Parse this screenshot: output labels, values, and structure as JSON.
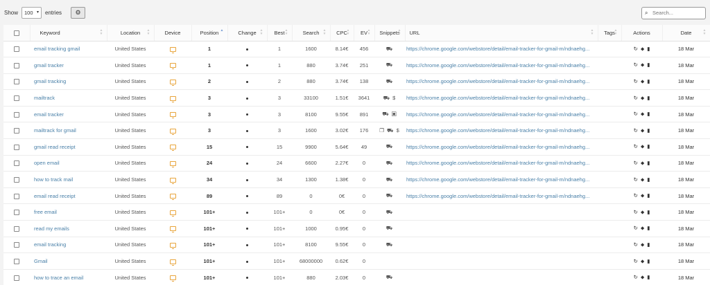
{
  "toolbar": {
    "show_label": "Show",
    "entries_value": "100",
    "entries_label": "entries",
    "search_placeholder": "Search..."
  },
  "columns": {
    "keyword": "Keyword",
    "location": "Location",
    "device": "Device",
    "position": "Position",
    "change": "Change",
    "best": "Best",
    "search": "Search",
    "cpc": "CPC",
    "ev": "EV",
    "snippets": "Snippets",
    "url": "URL",
    "tags": "Tags",
    "actions": "Actions",
    "date": "Date"
  },
  "rows": [
    {
      "keyword": "email tracking gmail",
      "location": "United States",
      "position": "1",
      "best": "1",
      "search": "1600",
      "cpc": "8.14€",
      "ev": "456",
      "snippets": "⛟",
      "url": "https://chrome.google.com/webstore/detail/email-tracker-for-gmail-m/ndnaehg...",
      "date": "18 Mar"
    },
    {
      "keyword": "gmail tracker",
      "location": "United States",
      "position": "1",
      "best": "1",
      "search": "880",
      "cpc": "3.74€",
      "ev": "251",
      "snippets": "⛟",
      "url": "https://chrome.google.com/webstore/detail/email-tracker-for-gmail-m/ndnaehg...",
      "date": "18 Mar"
    },
    {
      "keyword": "gmail tracking",
      "location": "United States",
      "position": "2",
      "best": "2",
      "search": "880",
      "cpc": "3.74€",
      "ev": "138",
      "snippets": "⛟",
      "url": "https://chrome.google.com/webstore/detail/email-tracker-for-gmail-m/ndnaehg...",
      "date": "18 Mar"
    },
    {
      "keyword": "mailtrack",
      "location": "United States",
      "position": "3",
      "best": "3",
      "search": "33100",
      "cpc": "1.51€",
      "ev": "3641",
      "snippets": "⛟ $",
      "url": "https://chrome.google.com/webstore/detail/email-tracker-for-gmail-m/ndnaehg...",
      "date": "18 Mar"
    },
    {
      "keyword": "email tracker",
      "location": "United States",
      "position": "3",
      "best": "3",
      "search": "8100",
      "cpc": "9.55€",
      "ev": "891",
      "snippets": "⛟ ▣",
      "url": "https://chrome.google.com/webstore/detail/email-tracker-for-gmail-m/ndnaehg...",
      "date": "18 Mar"
    },
    {
      "keyword": "mailtrack for gmail",
      "location": "United States",
      "position": "3",
      "best": "3",
      "search": "1600",
      "cpc": "3.02€",
      "ev": "176",
      "snippets": "❐ ⛟ $",
      "url": "https://chrome.google.com/webstore/detail/email-tracker-for-gmail-m/ndnaehg...",
      "date": "18 Mar"
    },
    {
      "keyword": "gmail read receipt",
      "location": "United States",
      "position": "15",
      "best": "15",
      "search": "9900",
      "cpc": "5.64€",
      "ev": "49",
      "snippets": "⛟",
      "url": "https://chrome.google.com/webstore/detail/email-tracker-for-gmail-m/ndnaehg...",
      "date": "18 Mar"
    },
    {
      "keyword": "open email",
      "location": "United States",
      "position": "24",
      "best": "24",
      "search": "6600",
      "cpc": "2.27€",
      "ev": "0",
      "snippets": "⛟",
      "url": "https://chrome.google.com/webstore/detail/email-tracker-for-gmail-m/ndnaehg...",
      "date": "18 Mar"
    },
    {
      "keyword": "how to track mail",
      "location": "United States",
      "position": "34",
      "best": "34",
      "search": "1300",
      "cpc": "1.38€",
      "ev": "0",
      "snippets": "⛟",
      "url": "https://chrome.google.com/webstore/detail/email-tracker-for-gmail-m/ndnaehg...",
      "date": "18 Mar"
    },
    {
      "keyword": "email read receipt",
      "location": "United States",
      "position": "89",
      "best": "89",
      "search": "0",
      "cpc": "0€",
      "ev": "0",
      "snippets": "⛟",
      "url": "https://chrome.google.com/webstore/detail/email-tracker-for-gmail-m/ndnaehg...",
      "date": "18 Mar"
    },
    {
      "keyword": "free email",
      "location": "United States",
      "position": "101+",
      "best": "101+",
      "search": "0",
      "cpc": "0€",
      "ev": "0",
      "snippets": "⛟",
      "url": "",
      "date": "18 Mar"
    },
    {
      "keyword": "read my emails",
      "location": "United States",
      "position": "101+",
      "best": "101+",
      "search": "1000",
      "cpc": "0.95€",
      "ev": "0",
      "snippets": "⛟",
      "url": "",
      "date": "18 Mar"
    },
    {
      "keyword": "email tracking",
      "location": "United States",
      "position": "101+",
      "best": "101+",
      "search": "8100",
      "cpc": "9.55€",
      "ev": "0",
      "snippets": "⛟",
      "url": "",
      "date": "18 Mar"
    },
    {
      "keyword": "Gmail",
      "location": "United States",
      "position": "101+",
      "best": "101+",
      "search": "68000000",
      "cpc": "0.62€",
      "ev": "0",
      "snippets": "",
      "url": "",
      "date": "18 Mar"
    },
    {
      "keyword": "how to trace an email",
      "location": "United States",
      "position": "101+",
      "best": "101+",
      "search": "880",
      "cpc": "2.03€",
      "ev": "0",
      "snippets": "⛟",
      "url": "",
      "date": "18 Mar"
    }
  ],
  "icons": {
    "device": "desktop-icon",
    "change": "dot-icon",
    "actions": [
      "refresh-icon",
      "tag-icon",
      "trash-icon"
    ]
  },
  "colors": {
    "link": "#4a80a8",
    "device": "#e8a43a",
    "sort_active": "#7a9fd6"
  }
}
